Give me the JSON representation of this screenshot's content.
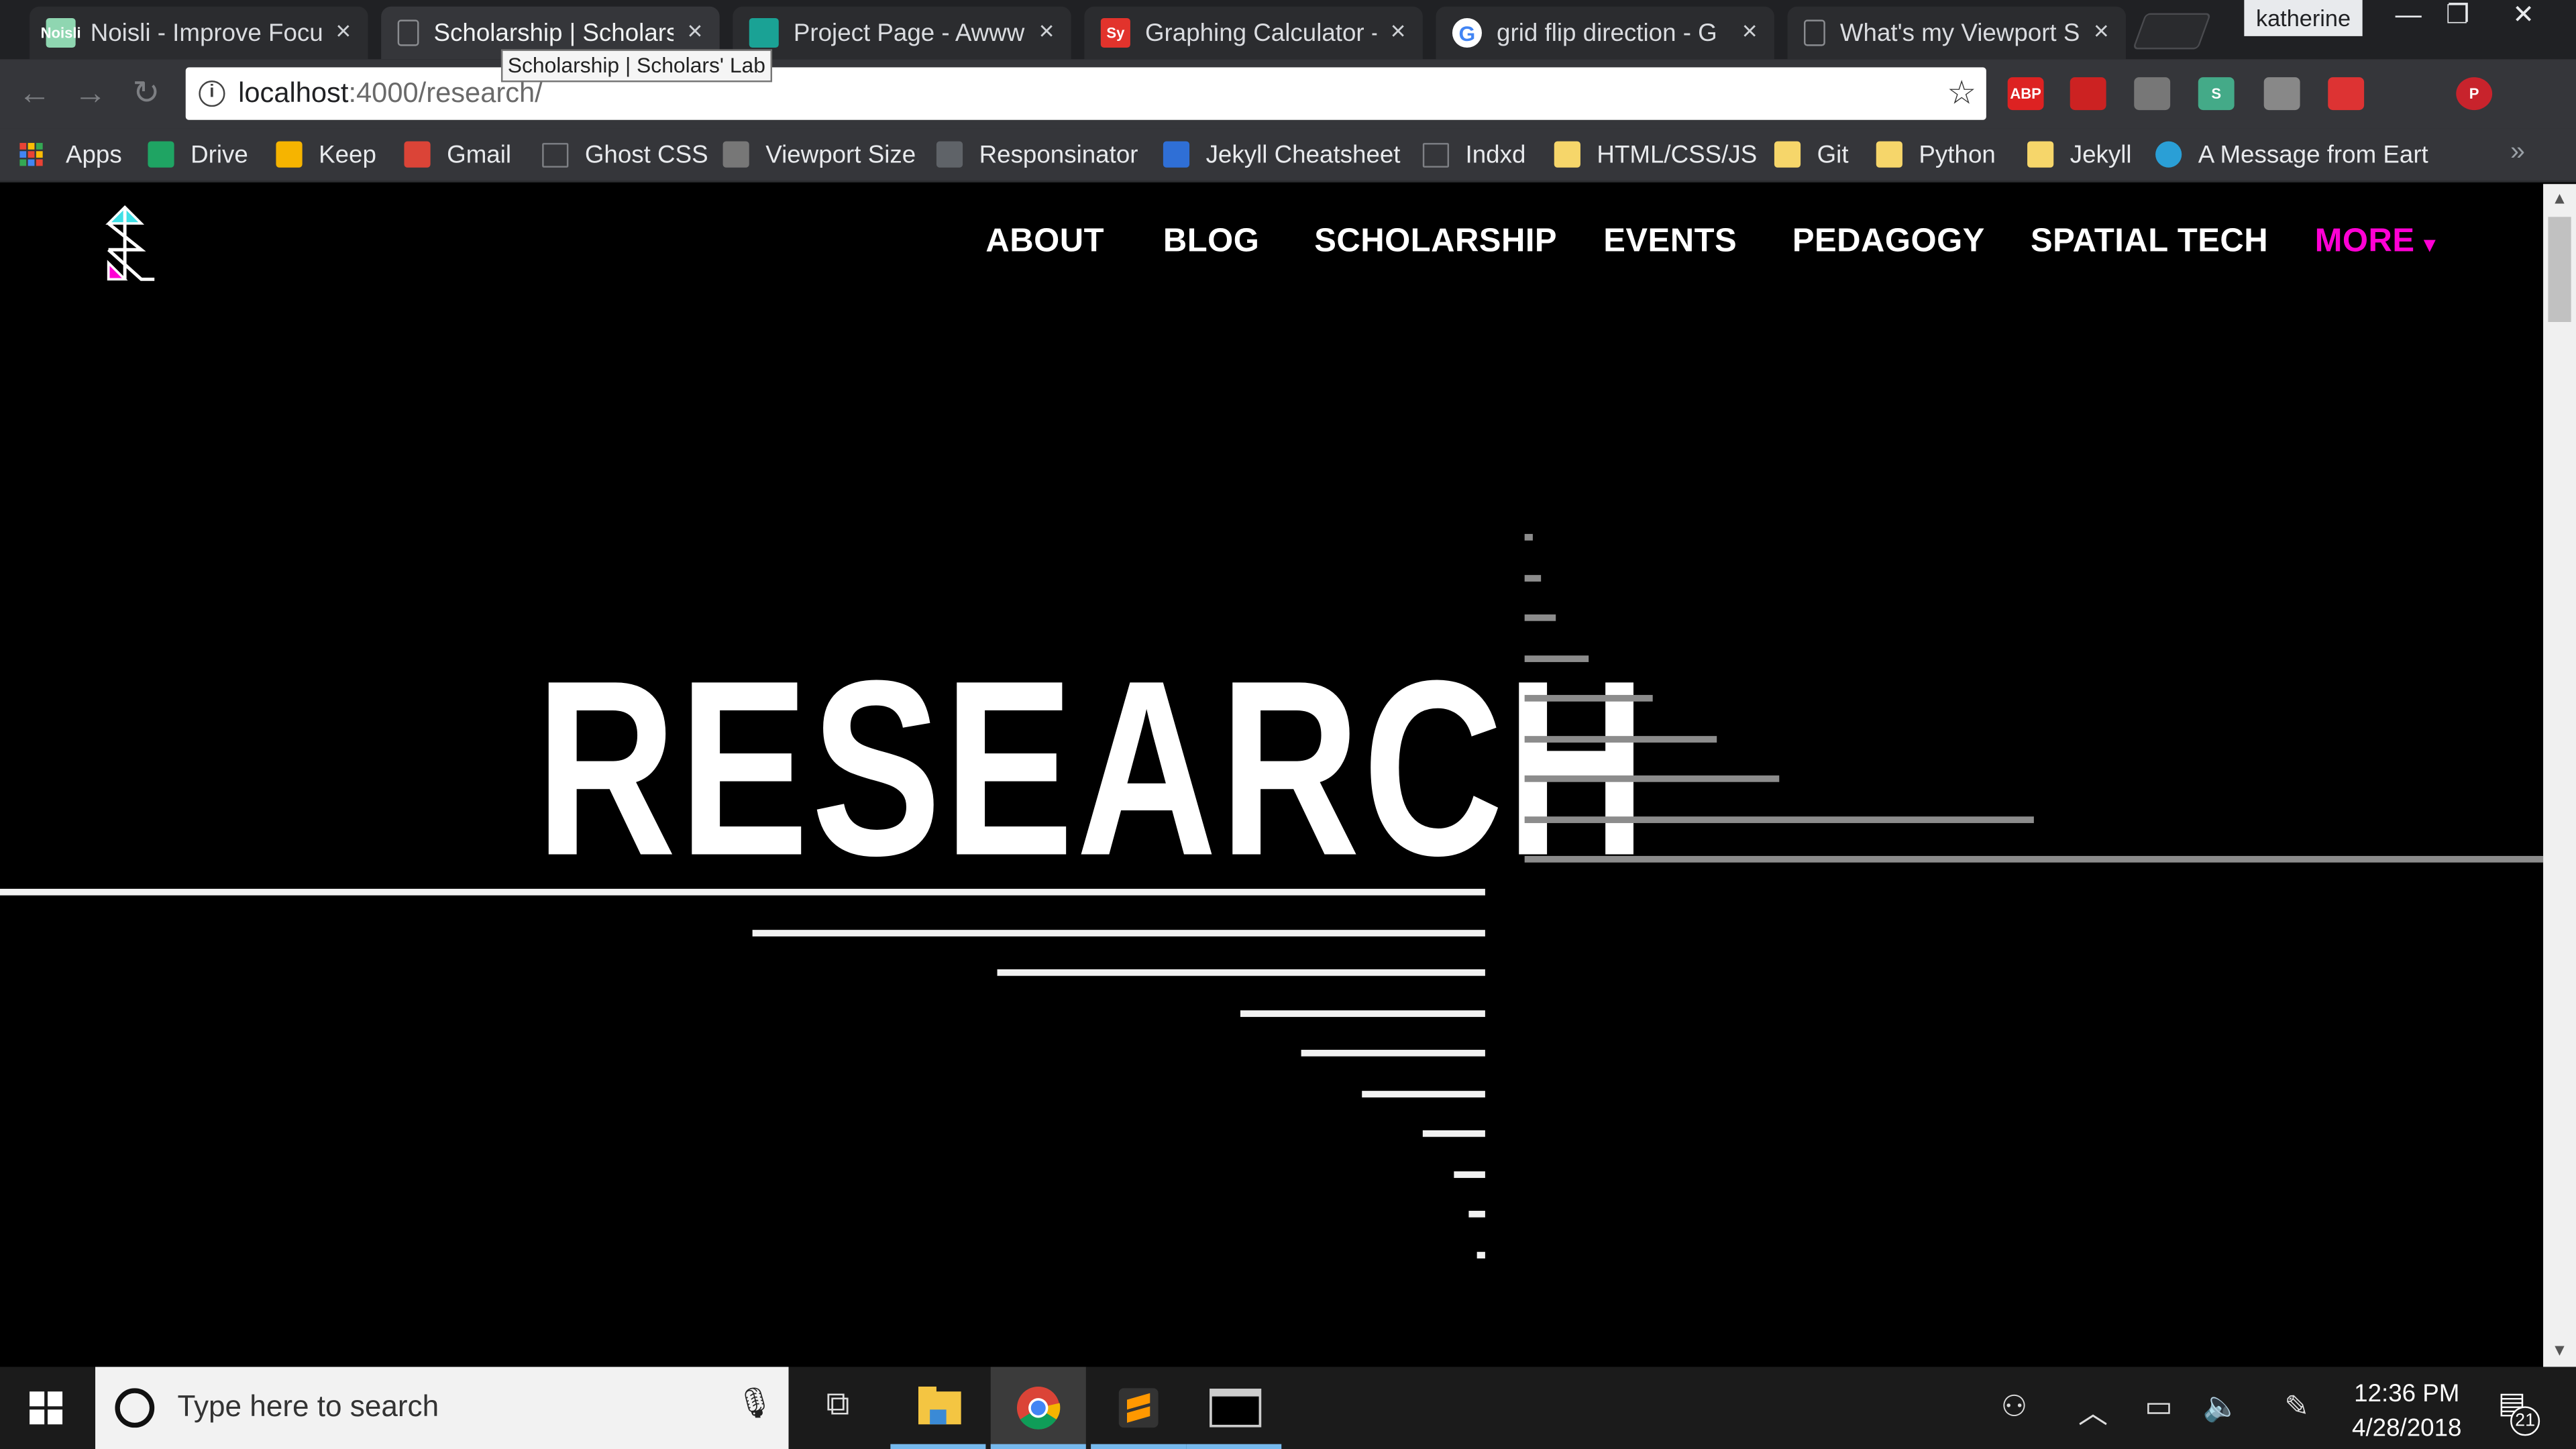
{
  "browser": {
    "profile_name": "katherine",
    "tooltip": "Scholarship | Scholars' Lab",
    "tabs": [
      {
        "title": "Noisli - Improve Focu",
        "favicon_color": "#8fd6b1",
        "favicon_text": "Noisli"
      },
      {
        "title": "Scholarship | Scholars",
        "favicon_color": "none",
        "favicon_text": ""
      },
      {
        "title": "Project Page - Awww",
        "favicon_color": "#1aa295",
        "favicon_text": ""
      },
      {
        "title": "Graphing Calculator -",
        "favicon_color": "#e2332c",
        "favicon_text": "Sy"
      },
      {
        "title": "grid flip direction - G",
        "favicon_color": "#ffffff",
        "favicon_text": "G"
      },
      {
        "title": "What's my Viewport S",
        "favicon_color": "none",
        "favicon_text": ""
      }
    ],
    "tab_close_glyph": "×",
    "url_host": "localhost",
    "url_rest": ":4000/research/",
    "bookmarks": [
      {
        "label": "Apps",
        "icon": "apps-grid"
      },
      {
        "label": "Drive",
        "icon": "drive-icon"
      },
      {
        "label": "Keep",
        "icon": "keep-icon"
      },
      {
        "label": "Gmail",
        "icon": "gmail-icon"
      },
      {
        "label": "Ghost CSS",
        "icon": "page-icon"
      },
      {
        "label": "Viewport Size",
        "icon": "viewport-icon"
      },
      {
        "label": "Responsinator",
        "icon": "responsinator-icon"
      },
      {
        "label": "Jekyll Cheatsheet",
        "icon": "jekyll-icon"
      },
      {
        "label": "Indxd",
        "icon": "page-icon"
      },
      {
        "label": "HTML/CSS/JS",
        "icon": "folder-icon"
      },
      {
        "label": "Git",
        "icon": "folder-icon"
      },
      {
        "label": "Python",
        "icon": "folder-icon"
      },
      {
        "label": "Jekyll",
        "icon": "folder-icon"
      },
      {
        "label": "A Message from Eart",
        "icon": "earth-icon"
      }
    ],
    "extensions": [
      {
        "name": "adblock-plus-icon",
        "text": "ABP",
        "color": "#d22"
      },
      {
        "name": "pdf-icon",
        "text": "",
        "color": "#c22"
      },
      {
        "name": "inspect-icon",
        "text": "",
        "color": "#777"
      },
      {
        "name": "scholar-icon",
        "text": "S",
        "color": "#4a8"
      },
      {
        "name": "bulb-icon",
        "text": "",
        "color": "#888"
      },
      {
        "name": "pocket-icon",
        "text": "",
        "color": "#d33"
      },
      {
        "name": "pinterest-icon",
        "text": "P",
        "color": "#c8232c"
      }
    ]
  },
  "site": {
    "nav": [
      "ABOUT",
      "BLOG",
      "SCHOLARSHIP",
      "EVENTS",
      "PEDAGOGY",
      "SPATIAL TECH"
    ],
    "nav_more": "MORE",
    "nav_more_caret": "▾",
    "hero_title": "RESEARCH",
    "colors": {
      "accent": "#ff00d4",
      "logo_cyan": "#3ee0e6",
      "logo_magenta": "#ff00d4",
      "white_bar": "#f2f2f2",
      "gray_bar": "#8c8c8c"
    }
  },
  "taskbar": {
    "search_placeholder": "Type here to search",
    "time": "12:36 PM",
    "date": "4/28/2018",
    "notification_count": "21"
  }
}
